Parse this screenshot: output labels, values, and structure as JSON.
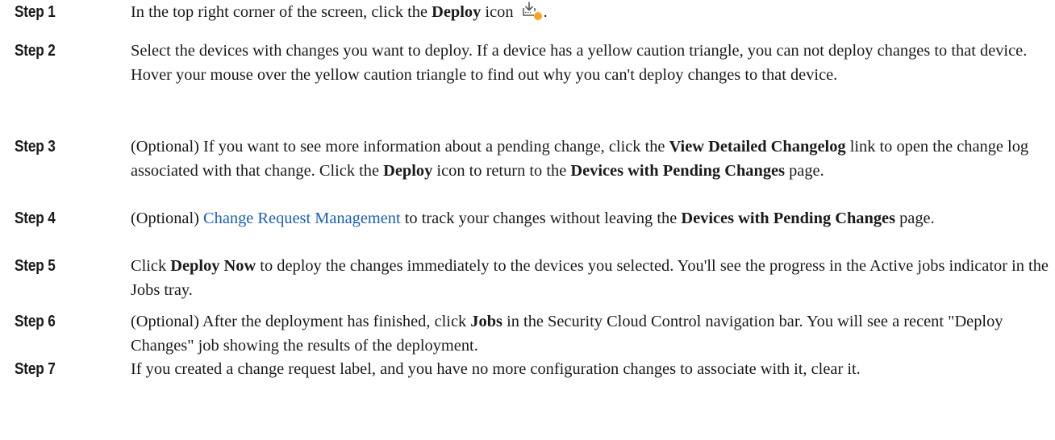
{
  "steps": [
    {
      "label": "Step 1",
      "parts": [
        {
          "t": "In the top right corner of the screen, click the "
        },
        {
          "t": "Deploy",
          "b": true
        },
        {
          "t": " icon "
        },
        {
          "icon": "deploy-icon"
        },
        {
          "t": "."
        }
      ]
    },
    {
      "label": "Step 2",
      "parts": [
        {
          "t": "Select the devices with changes you want to deploy. If a device has a yellow caution triangle, you can not deploy changes to that device. Hover your mouse over the yellow caution triangle to find out why you can't deploy changes to that device."
        }
      ]
    },
    {
      "label": "Step 3",
      "parts": [
        {
          "t": "(Optional) If you want to see more information about a pending change, click the "
        },
        {
          "t": "View Detailed Changelog",
          "b": true
        },
        {
          "t": " link to open the change log associated with that change. Click the "
        },
        {
          "t": "Deploy",
          "b": true
        },
        {
          "t": " icon to return to the "
        },
        {
          "t": "Devices with Pending Changes",
          "b": true
        },
        {
          "t": " page."
        }
      ]
    },
    {
      "label": "Step 4",
      "parts": [
        {
          "t": "(Optional) "
        },
        {
          "t": "Change Request Management",
          "link": true
        },
        {
          "t": " to track your changes without leaving the "
        },
        {
          "t": "Devices with Pending Changes",
          "b": true
        },
        {
          "t": " page."
        }
      ]
    },
    {
      "label": "Step 5",
      "parts": [
        {
          "t": "Click "
        },
        {
          "t": "Deploy Now",
          "b": true
        },
        {
          "t": " to deploy the changes immediately to the devices you selected. You'll see the progress in the Active jobs indicator in the Jobs tray."
        }
      ]
    },
    {
      "label": "Step 6",
      "parts": [
        {
          "t": "(Optional) After the deployment has finished, click "
        },
        {
          "t": "Jobs",
          "b": true
        },
        {
          "t": " in the Security Cloud Control navigation bar. You will see a recent \"Deploy Changes\" job showing the results of the deployment."
        }
      ]
    },
    {
      "label": "Step 7",
      "parts": [
        {
          "t": "If you created a change request label, and you have no more configuration changes to associate with it, clear it."
        }
      ]
    }
  ],
  "colors": {
    "text": "#1a1a1a",
    "link": "#1a5fb4",
    "deploy_dot": "#f5a623",
    "icon_stroke": "#555555"
  }
}
